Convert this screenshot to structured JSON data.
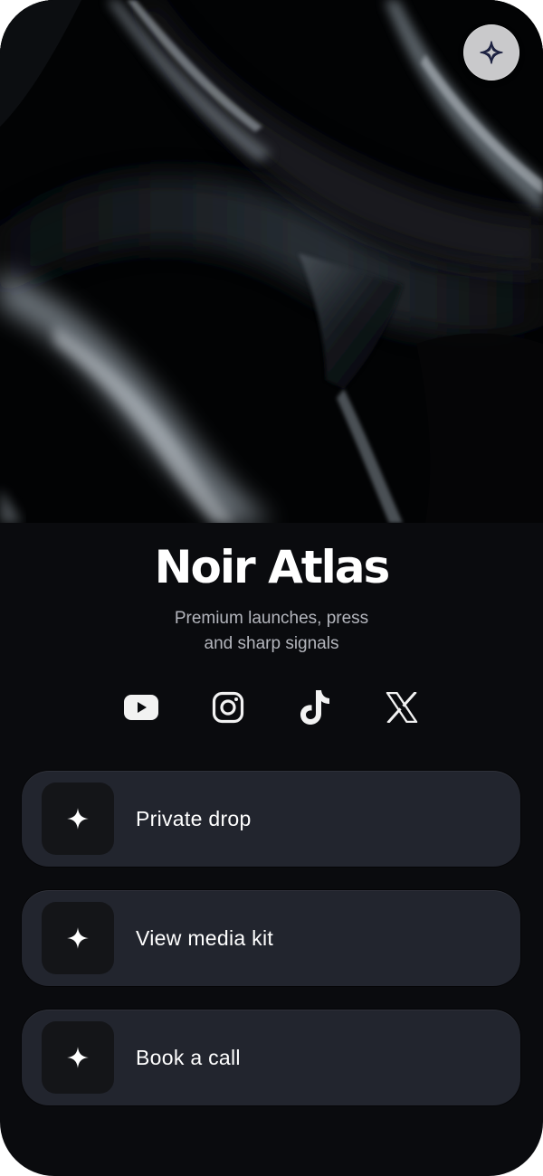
{
  "profile": {
    "name": "Noir Atlas",
    "description_line1": "Premium launches, press",
    "description_line2": "and sharp signals"
  },
  "top_action": {
    "icon": "sparkle-icon"
  },
  "socials": [
    {
      "name": "YouTube",
      "icon": "youtube-icon"
    },
    {
      "name": "Instagram",
      "icon": "instagram-icon"
    },
    {
      "name": "TikTok",
      "icon": "tiktok-icon"
    },
    {
      "name": "X",
      "icon": "x-icon"
    }
  ],
  "links": [
    {
      "label": "Private drop",
      "icon": "sparkle-icon"
    },
    {
      "label": "View media kit",
      "icon": "sparkle-icon"
    },
    {
      "label": "Book a call",
      "icon": "sparkle-icon"
    }
  ],
  "colors": {
    "background": "#0a0b0e",
    "card": "#22252e",
    "icon_box": "#141518",
    "text": "#ffffff",
    "muted_text": "#b4b6bd"
  }
}
